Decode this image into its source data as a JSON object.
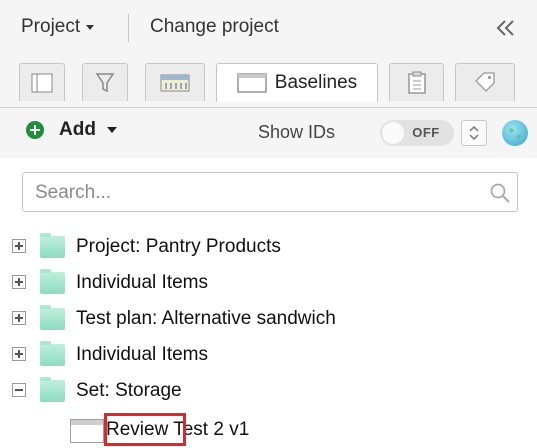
{
  "header": {
    "project_menu_label": "Project",
    "change_project_label": "Change project"
  },
  "tabs": [
    {
      "icon": "list-panel-icon",
      "label": ""
    },
    {
      "icon": "filter-icon",
      "label": ""
    },
    {
      "icon": "ruler-icon",
      "label": ""
    },
    {
      "icon": "window-icon",
      "label": "Baselines",
      "active": true
    },
    {
      "icon": "clipboard-icon",
      "label": ""
    },
    {
      "icon": "tag-icon",
      "label": ""
    }
  ],
  "toolbar": {
    "add_label": "Add",
    "show_ids_label": "Show IDs",
    "toggle_state": "OFF"
  },
  "search": {
    "placeholder": "Search..."
  },
  "tree": {
    "items": [
      {
        "label": "Project: Pantry Products",
        "expanded": false
      },
      {
        "label": "Individual Items",
        "expanded": false
      },
      {
        "label": "Test plan: Alternative sandwich",
        "expanded": false
      },
      {
        "label": "Individual Items",
        "expanded": false
      },
      {
        "label": "Set: Storage",
        "expanded": true
      }
    ],
    "child": {
      "label": "Review Test 2 v1",
      "highlight_word": "Review"
    }
  },
  "colors": {
    "add_icon": "#1f8f3a",
    "folder": "#8fdcc0",
    "highlight_border": "#e0262a"
  }
}
